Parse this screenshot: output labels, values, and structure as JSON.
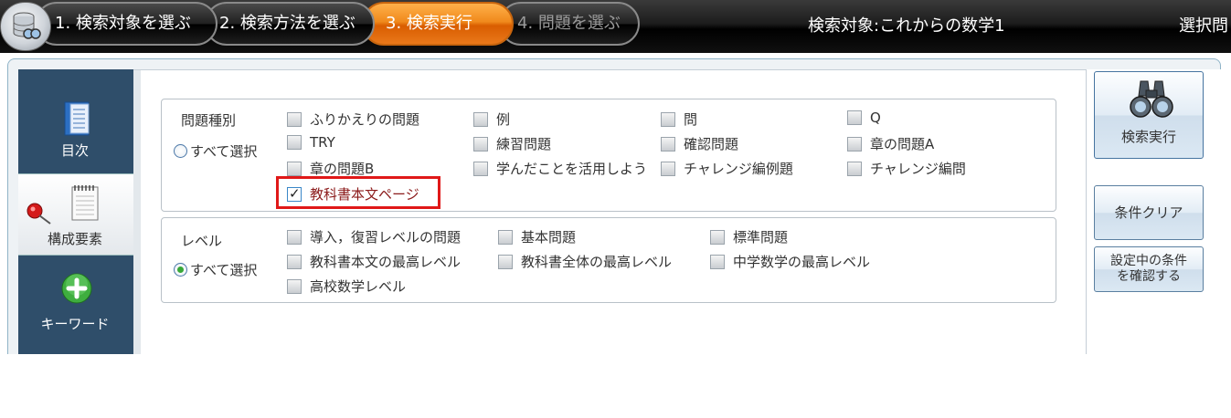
{
  "steps": [
    {
      "label": "1. 検索対象を選ぶ",
      "state": "done"
    },
    {
      "label": "2. 検索方法を選ぶ",
      "state": "done"
    },
    {
      "label": "3. 検索実行",
      "state": "current"
    },
    {
      "label": "4. 問題を選ぶ",
      "state": "disabled"
    }
  ],
  "header": {
    "search_target": "検索対象:これからの数学1",
    "selected_questions": "選択問"
  },
  "tabs": [
    {
      "label": "目次",
      "icon": "book-icon"
    },
    {
      "label": "構成要素",
      "icon": "notepad-pushpin-icon",
      "active": true
    },
    {
      "label": "キーワード",
      "icon": "plus-circle-icon"
    }
  ],
  "problem_type": {
    "title": "問題種別",
    "select_all": "すべて選択",
    "items": [
      {
        "label": "ふりかえりの問題",
        "checked": false
      },
      {
        "label": "例",
        "checked": false
      },
      {
        "label": "問",
        "checked": false
      },
      {
        "label": "Q",
        "checked": false
      },
      {
        "label": "TRY",
        "checked": false
      },
      {
        "label": "練習問題",
        "checked": false
      },
      {
        "label": "確認問題",
        "checked": false
      },
      {
        "label": "章の問題A",
        "checked": false
      },
      {
        "label": "章の問題B",
        "checked": false
      },
      {
        "label": "学んだことを活用しよう",
        "checked": false
      },
      {
        "label": "チャレンジ編例題",
        "checked": false
      },
      {
        "label": "チャレンジ編問",
        "checked": false
      },
      {
        "label": "教科書本文ページ",
        "checked": true
      }
    ]
  },
  "level": {
    "title": "レベル",
    "select_all": "すべて選択",
    "items": [
      {
        "label": "導入，復習レベルの問題",
        "checked": false
      },
      {
        "label": "基本問題",
        "checked": false
      },
      {
        "label": "標準問題",
        "checked": false
      },
      {
        "label": "教科書本文の最高レベル",
        "checked": false
      },
      {
        "label": "教科書全体の最高レベル",
        "checked": false
      },
      {
        "label": "中学数学の最高レベル",
        "checked": false
      },
      {
        "label": "高校数学レベル",
        "checked": false
      }
    ]
  },
  "buttons": {
    "search": "検索実行",
    "clear": "条件クリア",
    "confirm_line1": "設定中の条件",
    "confirm_line2": "を確認する"
  },
  "colors": {
    "accent_orange": "#f08a1c",
    "sidebar_navy": "#2f4e6a",
    "highlight_red": "#e01818"
  }
}
